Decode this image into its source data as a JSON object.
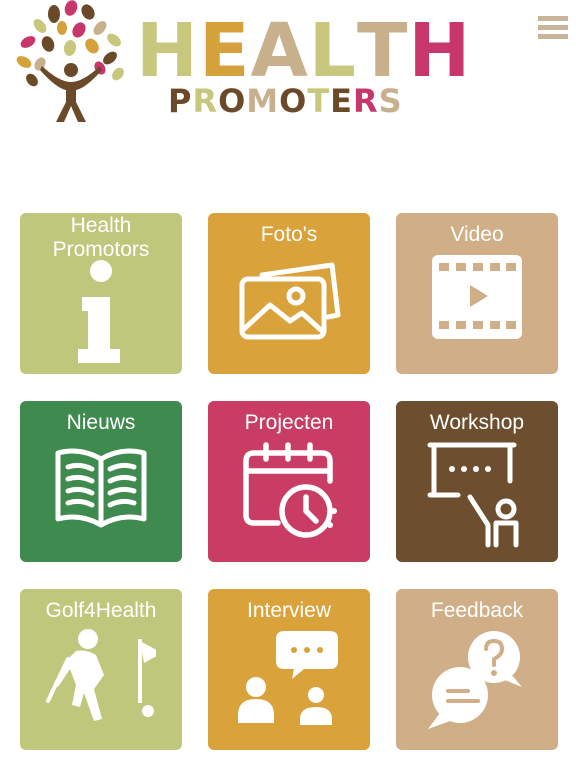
{
  "header": {
    "logo_word": [
      "H",
      "E",
      "A",
      "L",
      "T",
      "H"
    ],
    "logo_word_colors": [
      "#c7c77d",
      "#d4a13a",
      "#c9b08c",
      "#c7c77d",
      "#c9b08c",
      "#c7376b"
    ],
    "logo_sub": [
      "P",
      "R",
      "O",
      "M",
      "O",
      "T",
      "E",
      "R",
      "S"
    ],
    "logo_sub_colors": [
      "#6b4a2a",
      "#c7c77d",
      "#6b4a2a",
      "#c9b08c",
      "#6b4a2a",
      "#c7c77d",
      "#6b4a2a",
      "#c7376b",
      "#c9b08c"
    ],
    "menu_icon": "hamburger-icon"
  },
  "tiles": [
    {
      "label": "Health Promotors",
      "color": "#bfc77d",
      "icon": "info-icon"
    },
    {
      "label": "Foto's",
      "color": "#d9a23a",
      "icon": "photos-icon"
    },
    {
      "label": "Video",
      "color": "#cfae88",
      "icon": "video-icon"
    },
    {
      "label": "Nieuws",
      "color": "#3f8a4f",
      "icon": "book-icon"
    },
    {
      "label": "Projecten",
      "color": "#c93c64",
      "icon": "calendar-clock-icon"
    },
    {
      "label": "Workshop",
      "color": "#6d4e2f",
      "icon": "presentation-icon"
    },
    {
      "label": "Golf4Health",
      "color": "#bfc77d",
      "icon": "golf-icon"
    },
    {
      "label": "Interview",
      "color": "#d9a23a",
      "icon": "interview-icon"
    },
    {
      "label": "Feedback",
      "color": "#cfae88",
      "icon": "feedback-icon"
    }
  ]
}
